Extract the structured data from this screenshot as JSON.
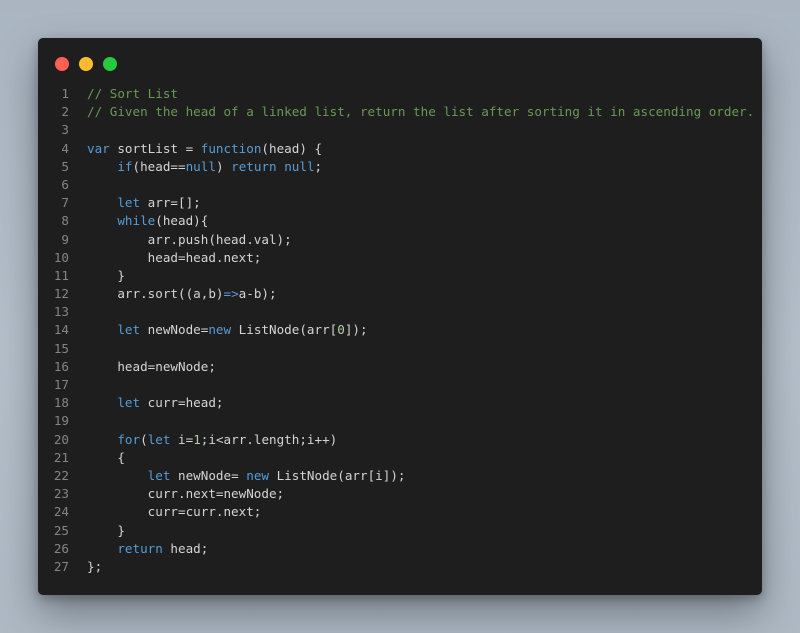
{
  "window": {
    "buttons": [
      "close",
      "minimize",
      "zoom"
    ],
    "colors": {
      "background": "#1e1e1e",
      "comment": "#6a9955",
      "keyword": "#569cd6",
      "text": "#d4d4d4",
      "number": "#b5cea8",
      "line_number": "#858585",
      "close_dot": "#ff5f56",
      "minimize_dot": "#ffbd2e",
      "zoom_dot": "#27c93f"
    }
  },
  "code": {
    "lines": [
      {
        "num": "1",
        "tokens": [
          {
            "t": "// Sort List",
            "k": "comment"
          }
        ]
      },
      {
        "num": "2",
        "tokens": [
          {
            "t": "// Given the head of a linked list, return the list after sorting it in ascending order.",
            "k": "comment"
          }
        ]
      },
      {
        "num": "3",
        "tokens": []
      },
      {
        "num": "4",
        "tokens": [
          {
            "t": "var",
            "k": "keyword"
          },
          {
            "t": " sortList = ",
            "k": "plain"
          },
          {
            "t": "function",
            "k": "keyword"
          },
          {
            "t": "(head) {",
            "k": "plain"
          }
        ]
      },
      {
        "num": "5",
        "tokens": [
          {
            "t": "    ",
            "k": "plain"
          },
          {
            "t": "if",
            "k": "keyword"
          },
          {
            "t": "(head==",
            "k": "plain"
          },
          {
            "t": "null",
            "k": "keyword"
          },
          {
            "t": ") ",
            "k": "plain"
          },
          {
            "t": "return",
            "k": "keyword"
          },
          {
            "t": " ",
            "k": "plain"
          },
          {
            "t": "null",
            "k": "keyword"
          },
          {
            "t": ";",
            "k": "plain"
          }
        ]
      },
      {
        "num": "6",
        "tokens": []
      },
      {
        "num": "7",
        "tokens": [
          {
            "t": "    ",
            "k": "plain"
          },
          {
            "t": "let",
            "k": "keyword"
          },
          {
            "t": " arr=[];",
            "k": "plain"
          }
        ]
      },
      {
        "num": "8",
        "tokens": [
          {
            "t": "    ",
            "k": "plain"
          },
          {
            "t": "while",
            "k": "keyword"
          },
          {
            "t": "(head){",
            "k": "plain"
          }
        ]
      },
      {
        "num": "9",
        "tokens": [
          {
            "t": "        arr.push(head.val);",
            "k": "plain"
          }
        ]
      },
      {
        "num": "10",
        "tokens": [
          {
            "t": "        head=head.next;",
            "k": "plain"
          }
        ]
      },
      {
        "num": "11",
        "tokens": [
          {
            "t": "    }",
            "k": "plain"
          }
        ]
      },
      {
        "num": "12",
        "tokens": [
          {
            "t": "    arr.sort((a,b)",
            "k": "plain"
          },
          {
            "t": "=>",
            "k": "keyword"
          },
          {
            "t": "a-b);",
            "k": "plain"
          }
        ]
      },
      {
        "num": "13",
        "tokens": []
      },
      {
        "num": "14",
        "tokens": [
          {
            "t": "    ",
            "k": "plain"
          },
          {
            "t": "let",
            "k": "keyword"
          },
          {
            "t": " newNode=",
            "k": "plain"
          },
          {
            "t": "new",
            "k": "keyword"
          },
          {
            "t": " ListNode(arr[",
            "k": "plain"
          },
          {
            "t": "0",
            "k": "number"
          },
          {
            "t": "]);",
            "k": "plain"
          }
        ]
      },
      {
        "num": "15",
        "tokens": []
      },
      {
        "num": "16",
        "tokens": [
          {
            "t": "    head=newNode;",
            "k": "plain"
          }
        ]
      },
      {
        "num": "17",
        "tokens": []
      },
      {
        "num": "18",
        "tokens": [
          {
            "t": "    ",
            "k": "plain"
          },
          {
            "t": "let",
            "k": "keyword"
          },
          {
            "t": " curr=head;",
            "k": "plain"
          }
        ]
      },
      {
        "num": "19",
        "tokens": []
      },
      {
        "num": "20",
        "tokens": [
          {
            "t": "    ",
            "k": "plain"
          },
          {
            "t": "for",
            "k": "keyword"
          },
          {
            "t": "(",
            "k": "plain"
          },
          {
            "t": "let",
            "k": "keyword"
          },
          {
            "t": " i=",
            "k": "plain"
          },
          {
            "t": "1",
            "k": "number"
          },
          {
            "t": ";i<arr.length;i++)",
            "k": "plain"
          }
        ]
      },
      {
        "num": "21",
        "tokens": [
          {
            "t": "    {",
            "k": "plain"
          }
        ]
      },
      {
        "num": "22",
        "tokens": [
          {
            "t": "        ",
            "k": "plain"
          },
          {
            "t": "let",
            "k": "keyword"
          },
          {
            "t": " newNode= ",
            "k": "plain"
          },
          {
            "t": "new",
            "k": "keyword"
          },
          {
            "t": " ListNode(arr[i]);",
            "k": "plain"
          }
        ]
      },
      {
        "num": "23",
        "tokens": [
          {
            "t": "        curr.next=newNode;",
            "k": "plain"
          }
        ]
      },
      {
        "num": "24",
        "tokens": [
          {
            "t": "        curr=curr.next;",
            "k": "plain"
          }
        ]
      },
      {
        "num": "25",
        "tokens": [
          {
            "t": "    }",
            "k": "plain"
          }
        ]
      },
      {
        "num": "26",
        "tokens": [
          {
            "t": "    ",
            "k": "plain"
          },
          {
            "t": "return",
            "k": "keyword"
          },
          {
            "t": " head;",
            "k": "plain"
          }
        ]
      },
      {
        "num": "27",
        "tokens": [
          {
            "t": "};",
            "k": "plain"
          }
        ]
      }
    ]
  }
}
